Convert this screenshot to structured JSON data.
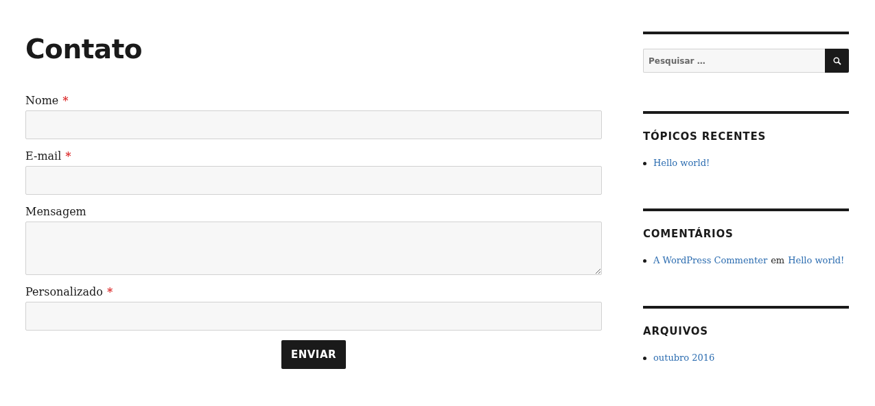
{
  "page_title": "Contato",
  "form": {
    "fields": [
      {
        "label": "Nome",
        "marker": "*",
        "kind": "text"
      },
      {
        "label": "E-mail",
        "marker": "*",
        "kind": "text"
      },
      {
        "label": "Mensagem",
        "kind": "textarea"
      },
      {
        "label": "Personalizado",
        "marker": "*",
        "kind": "text"
      }
    ],
    "submit": "ENVIAR"
  },
  "sidebar": {
    "search": {
      "placeholder": "Pesquisar …"
    },
    "widgets": [
      {
        "title": "TÓPICOS RECENTES",
        "items": [
          [
            {
              "kind": "link",
              "text": "Hello world!"
            }
          ]
        ]
      },
      {
        "title": "COMENTÁRIOS",
        "items": [
          [
            {
              "kind": "link",
              "text": "A WordPress Commenter"
            },
            {
              "kind": "text",
              "text": "em"
            },
            {
              "kind": "link",
              "text": "Hello world!"
            }
          ]
        ]
      },
      {
        "title": "ARQUIVOS",
        "items": [
          [
            {
              "kind": "link",
              "text": "outubro 2016"
            }
          ]
        ]
      }
    ]
  }
}
